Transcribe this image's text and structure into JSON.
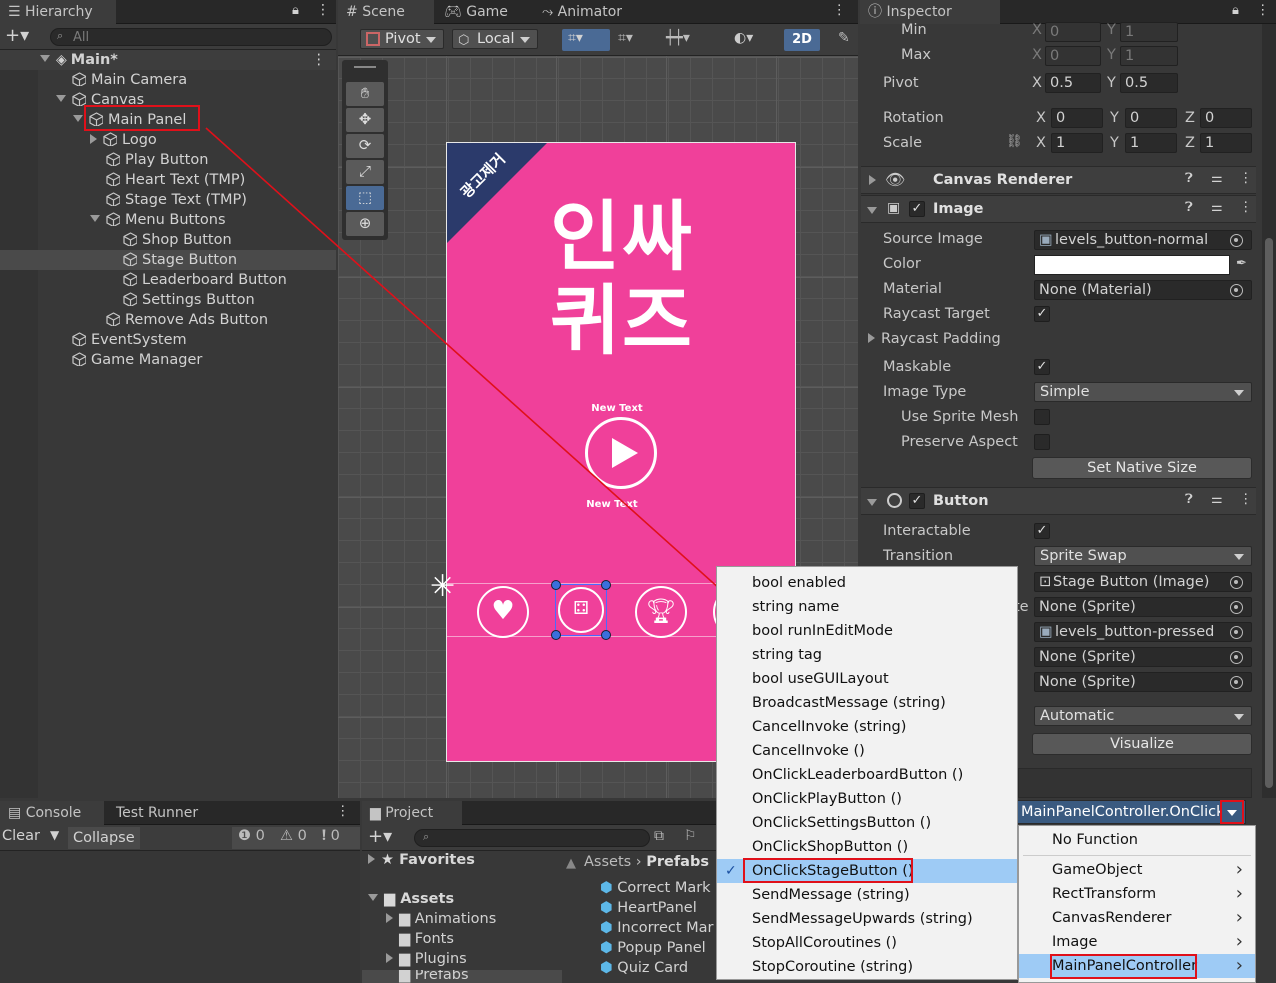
{
  "hierarchy": {
    "tab_label": "Hierarchy",
    "search_placeholder": "All",
    "scene": "Main*",
    "items": [
      {
        "label": "Main Camera",
        "level": 1
      },
      {
        "label": "Canvas",
        "level": 1
      },
      {
        "label": "Main Panel",
        "level": 2
      },
      {
        "label": "Logo",
        "level": 3
      },
      {
        "label": "Play Button",
        "level": 3
      },
      {
        "label": "Heart Text (TMP)",
        "level": 3
      },
      {
        "label": "Stage Text (TMP)",
        "level": 3
      },
      {
        "label": "Menu Buttons",
        "level": 3
      },
      {
        "label": "Shop Button",
        "level": 4
      },
      {
        "label": "Stage Button",
        "level": 4
      },
      {
        "label": "Leaderboard Button",
        "level": 4
      },
      {
        "label": "Settings Button",
        "level": 4
      },
      {
        "label": "Remove Ads Button",
        "level": 3
      },
      {
        "label": "EventSystem",
        "level": 1
      },
      {
        "label": "Game Manager",
        "level": 1
      }
    ]
  },
  "scene_view": {
    "tabs": [
      "Scene",
      "Game",
      "Animator"
    ],
    "pivot": "Pivot",
    "local": "Local",
    "mode_2d": "2D",
    "game": {
      "ad_banner": "광고제거",
      "title_line1": "인싸",
      "title_line2": "퀴즈",
      "new_text_top": "New Text",
      "new_text_bottom": "New Text"
    }
  },
  "console": {
    "tabs": [
      "Console",
      "Test Runner"
    ],
    "clear": "Clear",
    "collapse": "Collapse",
    "counts": [
      "0",
      "0",
      "0"
    ]
  },
  "project": {
    "tab": "Project",
    "favorites": "Favorites",
    "assets": "Assets",
    "folders": [
      "Animations",
      "Fonts",
      "Plugins",
      "Prefabs"
    ],
    "breadcrumb": [
      "Assets",
      "Prefabs"
    ],
    "prefabs": [
      "Correct Mark",
      "HeartPanel",
      "Incorrect Mar",
      "Popup Panel",
      "Quiz Card"
    ]
  },
  "inspector": {
    "tab": "Inspector",
    "min_label": "Min",
    "max_label": "Max",
    "pivot_label": "Pivot",
    "rotation_label": "Rotation",
    "scale_label": "Scale",
    "min": {
      "x": "0",
      "y": "1"
    },
    "max": {
      "x": "0",
      "y": "1"
    },
    "pivot": {
      "x": "0.5",
      "y": "0.5"
    },
    "rotation": {
      "x": "0",
      "y": "0",
      "z": "0"
    },
    "scale": {
      "x": "1",
      "y": "1",
      "z": "1"
    },
    "canvas_renderer": "Canvas Renderer",
    "image": {
      "title": "Image",
      "source_image_label": "Source Image",
      "source_image": "levels_button-normal",
      "color_label": "Color",
      "material_label": "Material",
      "material": "None (Material)",
      "raycast_target_label": "Raycast Target",
      "raycast_padding_label": "Raycast Padding",
      "maskable_label": "Maskable",
      "image_type_label": "Image Type",
      "image_type": "Simple",
      "use_sprite_mesh_label": "Use Sprite Mesh",
      "preserve_aspect_label": "Preserve Aspect",
      "set_native_size": "Set Native Size"
    },
    "button": {
      "title": "Button",
      "interactable_label": "Interactable",
      "transition_label": "Transition",
      "transition": "Sprite Swap",
      "target_graphic": "Stage Button (Image)",
      "highlighted": "None (Sprite)",
      "pressed": "levels_button-pressed",
      "selected": "None (Sprite)",
      "disabled": "None (Sprite)",
      "navigation": "Automatic",
      "visualize": "Visualize",
      "onclick_function": "MainPanelController.OnClick"
    },
    "axis": {
      "x": "X",
      "y": "Y",
      "z": "Z"
    },
    "partial_label": "te"
  },
  "method_menu": {
    "items": [
      "bool enabled",
      "string name",
      "bool runInEditMode",
      "string tag",
      "bool useGUILayout",
      "BroadcastMessage (string)",
      "CancelInvoke (string)",
      "CancelInvoke ()",
      "OnClickLeaderboardButton ()",
      "OnClickPlayButton ()",
      "OnClickSettingsButton ()",
      "OnClickShopButton ()",
      "OnClickStageButton ()",
      "SendMessage (string)",
      "SendMessageUpwards (string)",
      "StopAllCoroutines ()",
      "StopCoroutine (string)"
    ],
    "checkmark": "✓"
  },
  "component_menu": {
    "items": [
      "No Function",
      "GameObject",
      "RectTransform",
      "CanvasRenderer",
      "Image",
      "MainPanelController"
    ]
  },
  "colors": {
    "accent_red": "#e0101a",
    "game_pink": "#f0409a",
    "banner_navy": "#2b3a6b",
    "menu_highlight": "#9ecbf5"
  }
}
